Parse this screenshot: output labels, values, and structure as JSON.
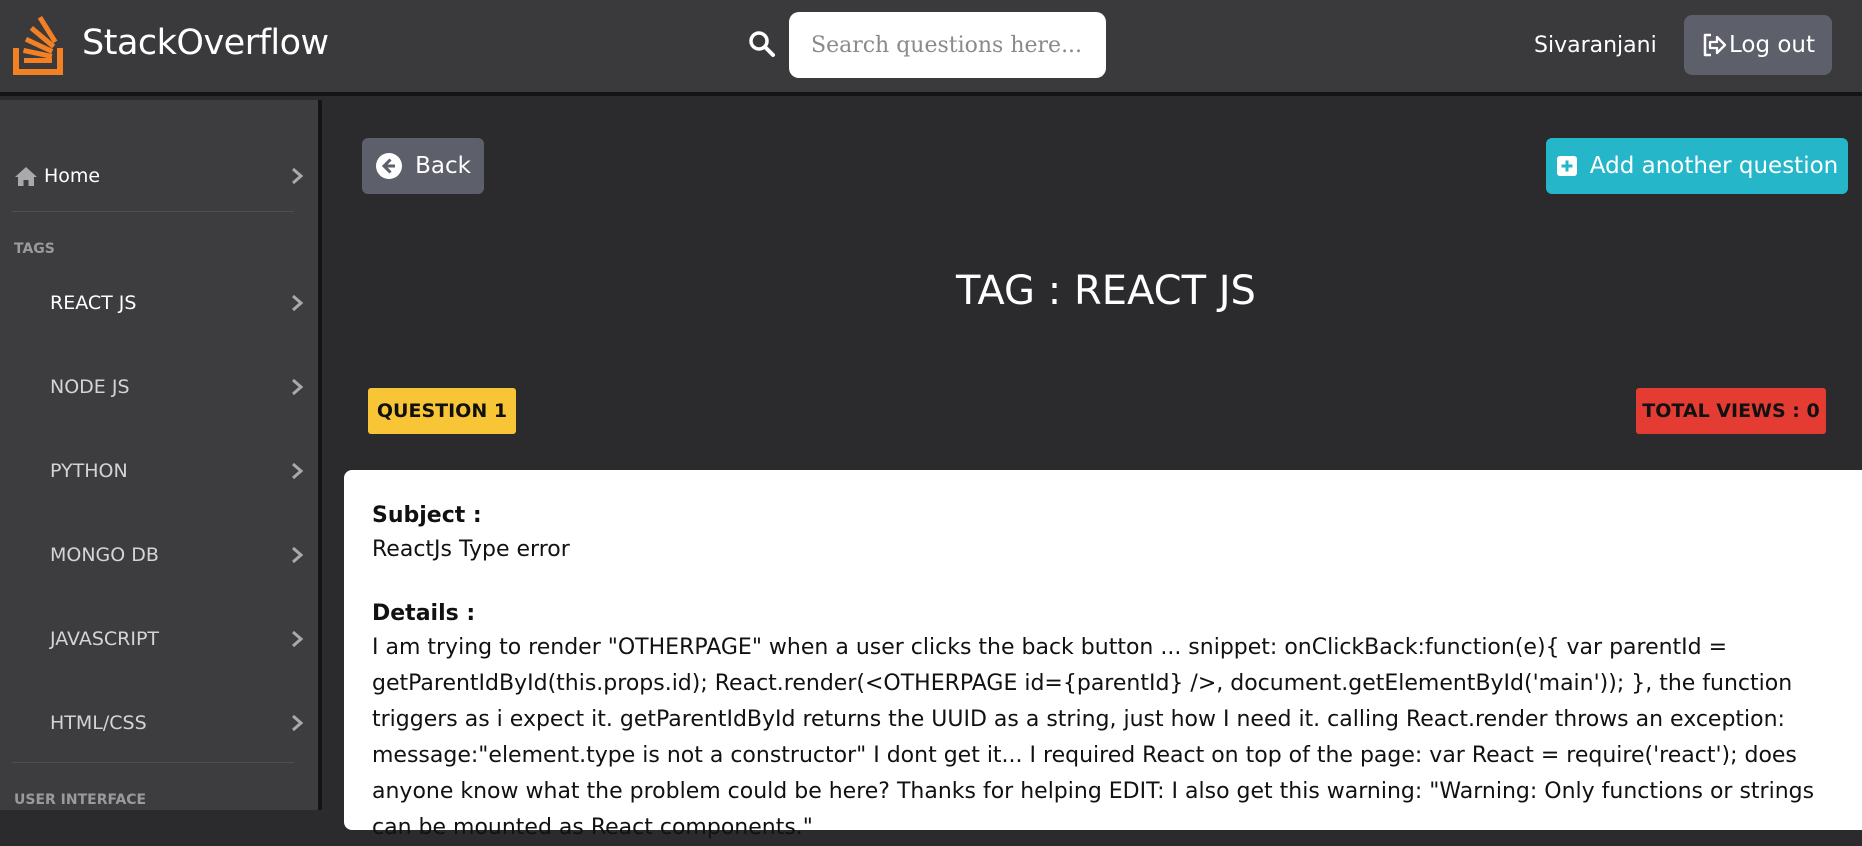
{
  "header": {
    "brand": "StackOverflow",
    "search_placeholder": "Search questions here...",
    "username": "Sivaranjani",
    "logout_label": "Log out"
  },
  "sidebar": {
    "home_label": "Home",
    "tags_title": "TAGS",
    "tags": [
      "REACT JS",
      "NODE JS",
      "PYTHON",
      "MONGO DB",
      "JAVASCRIPT",
      "HTML/CSS"
    ],
    "ui_title": "USER INTERFACE"
  },
  "main": {
    "back_label": "Back",
    "add_label": "Add another question",
    "title": "TAG : REACT JS",
    "question_badge": "QUESTION 1",
    "views_badge": "TOTAL VIEWS : 0",
    "subject_label": "Subject :",
    "subject_value": "ReactJs Type error",
    "details_label": "Details :",
    "details_value": "I am trying to render \"OTHERPAGE\" when a user clicks the back button ... snippet: onClickBack:function(e){ var parentId = getParentIdById(this.props.id); React.render(<OTHERPAGE id={parentId} />, document.getElementById('main')); }, the function triggers as i expect it. getParentIdById returns the UUID as a string, just how I need it. calling React.render throws an exception: message:\"element.type is not a constructor\" I dont get it... I required React on top of the page: var React = require('react'); does anyone know what the problem could be here? Thanks for helping EDIT: I also get this warning: \"Warning: Only functions or strings can be mounted as React components.\""
  },
  "colors": {
    "logo_orange": "#f48024",
    "badge_yellow": "#f8c537",
    "badge_red": "#e43b33",
    "accent_cyan": "#25b6c9",
    "button_gray": "#5d5f6a"
  },
  "icons": [
    "stackoverflow-logo-icon",
    "search-icon",
    "logout-icon",
    "home-icon",
    "chevron-right-icon",
    "arrow-left-circle-icon",
    "plus-square-icon"
  ]
}
